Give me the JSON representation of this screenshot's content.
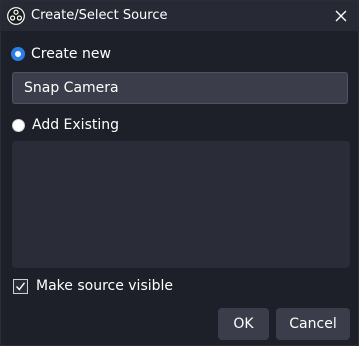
{
  "window": {
    "title": "Create/Select Source",
    "app_icon": "obs-logo-icon",
    "close_icon": "close-icon"
  },
  "options": {
    "create_new": {
      "label": "Create new",
      "selected": true
    },
    "add_existing": {
      "label": "Add Existing",
      "selected": false
    }
  },
  "name_input": {
    "value": "Snap Camera"
  },
  "existing_sources": [],
  "make_visible": {
    "label": "Make source visible",
    "checked": true
  },
  "buttons": {
    "ok": "OK",
    "cancel": "Cancel"
  },
  "colors": {
    "background": "#1e2029",
    "titlebar": "#272a35",
    "accent": "#2b7de9",
    "input_bg": "#3b3e4a",
    "list_bg": "#2a2d38"
  }
}
